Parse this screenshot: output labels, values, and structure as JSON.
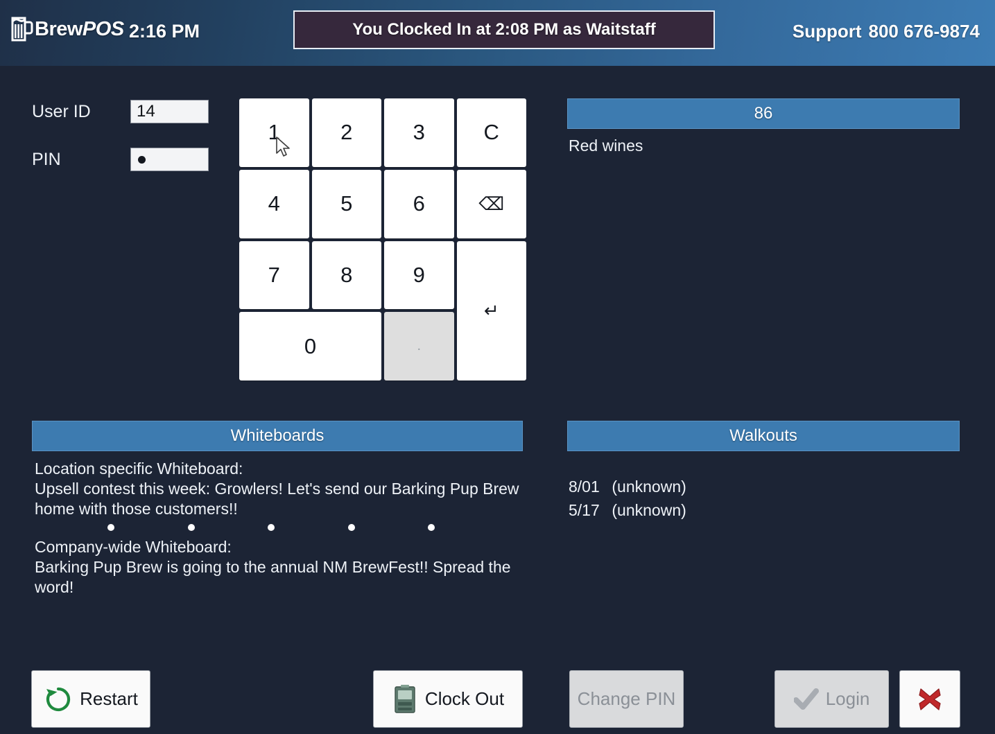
{
  "header": {
    "logo_text_brew": "Brew",
    "logo_text_pos": "POS",
    "logo_icon": "beer-mug-icon",
    "time": "2:16 PM",
    "clock_banner": "You Clocked In at 2:08 PM as Waitstaff",
    "support_label": "Support",
    "support_number": "800 676-9874"
  },
  "login": {
    "user_id_label": "User ID",
    "user_id_value": "14",
    "pin_label": "PIN",
    "pin_value": "●",
    "pin_masked_count": 1
  },
  "keypad": {
    "keys": [
      {
        "label": "1",
        "name": "key-1",
        "type": "digit"
      },
      {
        "label": "2",
        "name": "key-2",
        "type": "digit"
      },
      {
        "label": "3",
        "name": "key-3",
        "type": "digit"
      },
      {
        "label": "C",
        "name": "key-clear",
        "type": "clear"
      },
      {
        "label": "4",
        "name": "key-4",
        "type": "digit"
      },
      {
        "label": "5",
        "name": "key-5",
        "type": "digit"
      },
      {
        "label": "6",
        "name": "key-6",
        "type": "digit"
      },
      {
        "label": "⌫",
        "name": "key-backspace",
        "type": "backspace"
      },
      {
        "label": "7",
        "name": "key-7",
        "type": "digit"
      },
      {
        "label": "8",
        "name": "key-8",
        "type": "digit"
      },
      {
        "label": "9",
        "name": "key-9",
        "type": "digit"
      },
      {
        "label": "↵",
        "name": "key-enter",
        "type": "enter"
      },
      {
        "label": "0",
        "name": "key-0",
        "type": "digit"
      },
      {
        "label": ".",
        "name": "key-decimal",
        "type": "decimal"
      }
    ]
  },
  "eightysix": {
    "title": "86",
    "items": [
      "Red wines"
    ]
  },
  "whiteboards": {
    "title": "Whiteboards",
    "location_heading": "Location specific Whiteboard:",
    "location_body": "Upsell contest this week: Growlers! Let's send our Barking Pup Brew home with those customers!!",
    "separator_dot_count": 5,
    "company_heading": "Company-wide Whiteboard:",
    "company_body": "Barking Pup Brew is going to the annual NM BrewFest!! Spread the word!"
  },
  "walkouts": {
    "title": "Walkouts",
    "rows": [
      {
        "date": "8/01",
        "name": "(unknown)"
      },
      {
        "date": "5/17",
        "name": "(unknown)"
      }
    ]
  },
  "actions": {
    "restart": "Restart",
    "restart_icon": "refresh-circle-icon",
    "clock_out": "Clock Out",
    "clock_out_icon": "time-clock-icon",
    "change_pin": "Change PIN",
    "login": "Login",
    "login_icon": "checkmark-icon",
    "close_icon": "red-x-close-icon"
  },
  "colors": {
    "background": "#1c2435",
    "panel_header_blue": "#3d7bb0",
    "header_gradient_left": "#1f3048",
    "header_gradient_right": "#3d7cb4",
    "banner_bg": "#36283c",
    "key_white": "#ffffff",
    "key_disabled": "#dedede",
    "restart_green": "#1f8a3e",
    "close_red": "#c0282a"
  }
}
